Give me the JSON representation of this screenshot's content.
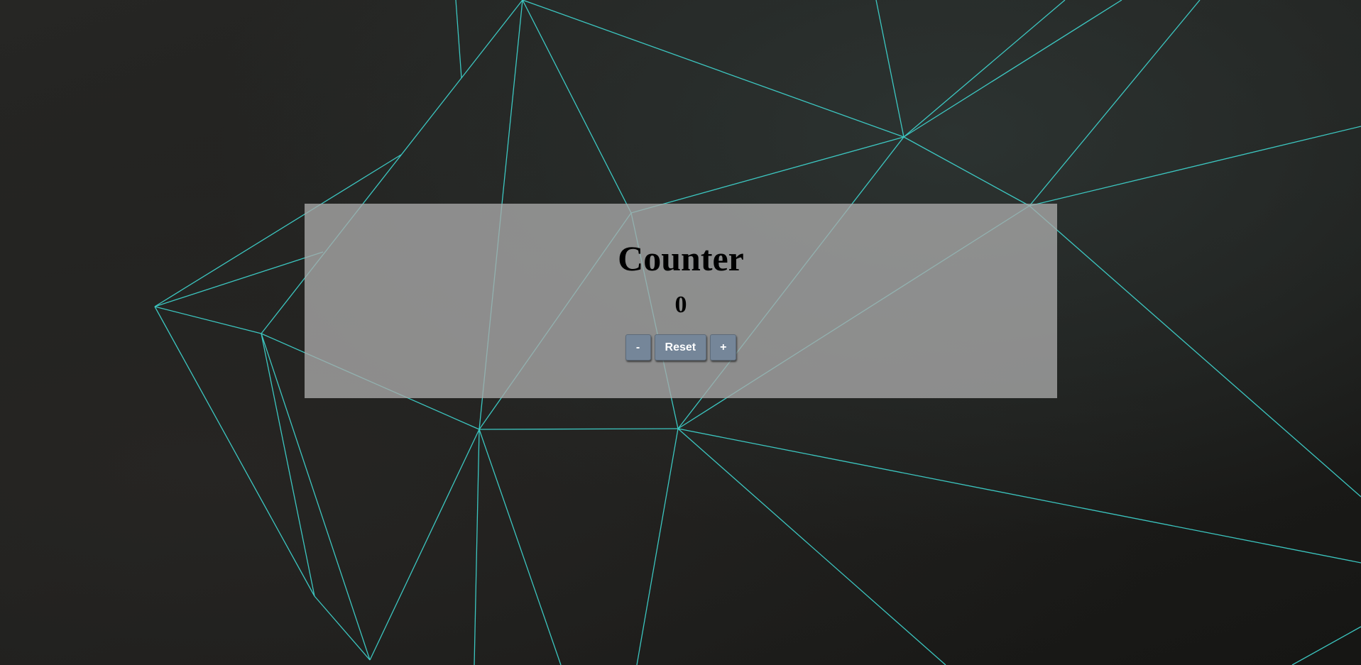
{
  "counter": {
    "title": "Counter",
    "value": "0",
    "decrement_label": "-",
    "reset_label": "Reset",
    "increment_label": "+"
  },
  "theme": {
    "mesh_line_color": "#3fd8d2",
    "button_color": "#758699",
    "panel_color": "#aaaaaa"
  }
}
